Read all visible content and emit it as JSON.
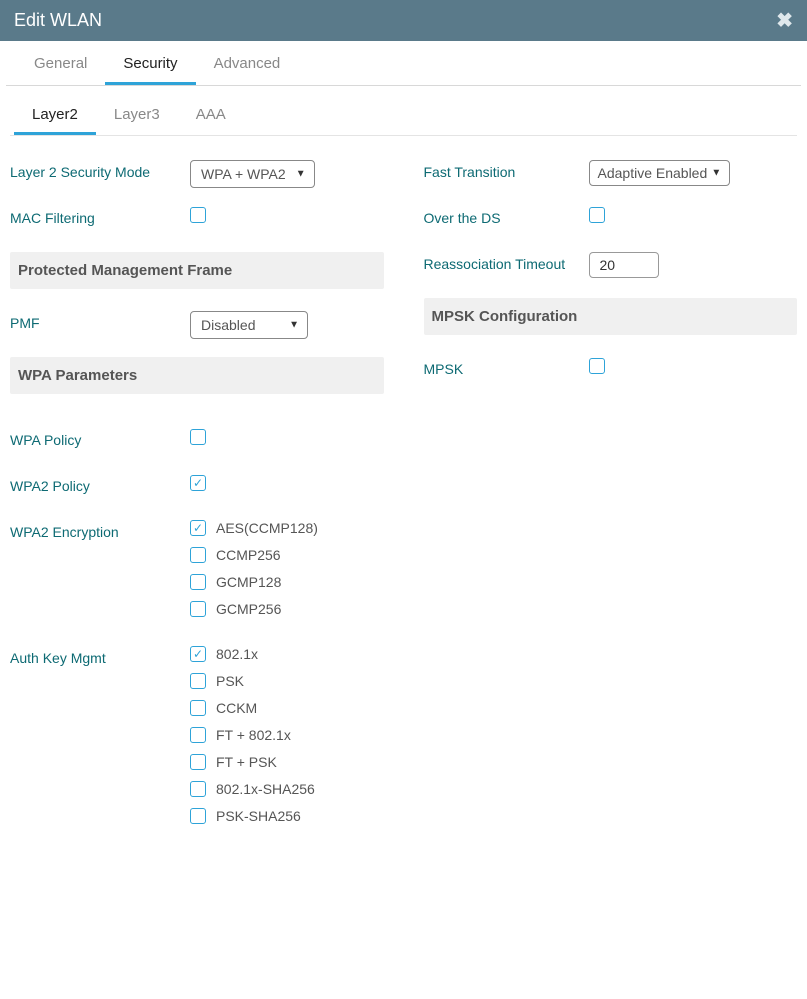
{
  "header": {
    "title": "Edit WLAN"
  },
  "tabs": {
    "general": "General",
    "security": "Security",
    "advanced": "Advanced"
  },
  "subtabs": {
    "layer2": "Layer2",
    "layer3": "Layer3",
    "aaa": "AAA"
  },
  "left": {
    "security_mode_label": "Layer 2 Security Mode",
    "security_mode_value": "WPA + WPA2",
    "mac_filtering_label": "MAC Filtering",
    "pmf_section": "Protected Management Frame",
    "pmf_label": "PMF",
    "pmf_value": "Disabled",
    "wpa_section": "WPA Parameters",
    "wpa_policy_label": "WPA Policy",
    "wpa2_policy_label": "WPA2 Policy",
    "wpa2_enc_label": "WPA2 Encryption",
    "enc_opts": [
      "AES(CCMP128)",
      "CCMP256",
      "GCMP128",
      "GCMP256"
    ],
    "akm_label": "Auth Key Mgmt",
    "akm_opts": [
      "802.1x",
      "PSK",
      "CCKM",
      "FT + 802.1x",
      "FT + PSK",
      "802.1x-SHA256",
      "PSK-SHA256"
    ]
  },
  "right": {
    "ft_label": "Fast Transition",
    "ft_value": "Adaptive Enabled",
    "over_ds_label": "Over the DS",
    "reassoc_label": "Reassociation Timeout",
    "reassoc_value": "20",
    "mpsk_section": "MPSK Configuration",
    "mpsk_label": "MPSK"
  }
}
